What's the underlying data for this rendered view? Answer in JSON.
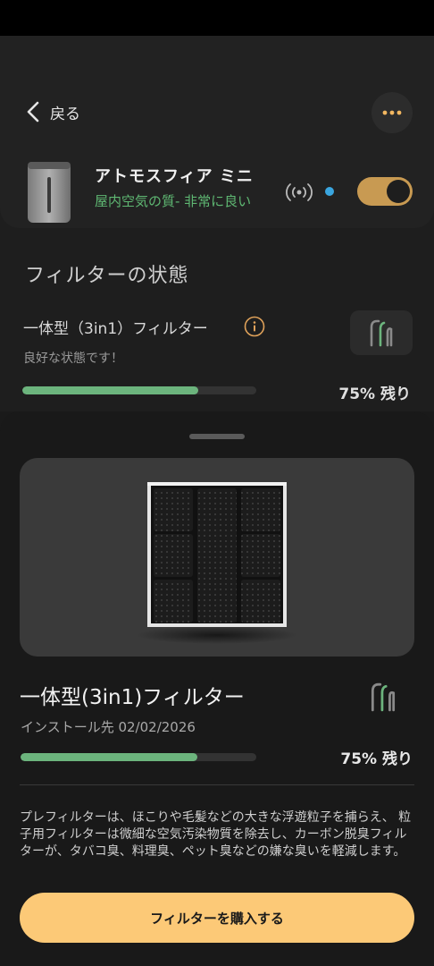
{
  "header": {
    "back_label": "戻る",
    "device_name": "アトモスフィア ミニ",
    "air_quality": "屋内空気の質- 非常に良い",
    "power_on": true
  },
  "filter_status": {
    "section_title": "フィルターの状態",
    "filter_name": "一体型（3in1）フィルター",
    "condition": "良好な状態です！",
    "remaining_percent": 75,
    "remaining_label": "75% 残り"
  },
  "detail": {
    "title": "一体型(3in1)フィルター",
    "install_date": "インストール先 02/02/2026",
    "remaining_percent": 75,
    "remaining_label": "75% 残り",
    "description": "プレフィルターは、ほこりや毛髪などの大きな浮遊粒子を捕らえ、 粒子用フィルターは微細な空気汚染物質を除去し、カーボン脱臭フィルターが、タバコ臭、料理臭、ペット臭などの嫌な臭いを軽減します。",
    "buy_button": "フィルターを購入する"
  },
  "colors": {
    "accent_toggle": "#c89a52",
    "progress": "#6cb47d",
    "status_green": "#5fb873",
    "buy_button": "#fcc977",
    "wifi_dot": "#3aa6e0"
  },
  "icons": {
    "back": "chevron-left-icon",
    "more": "more-horizontal-icon",
    "wifi": "wireless-signal-icon",
    "info": "info-circle-icon",
    "filter": "filter-icon"
  }
}
